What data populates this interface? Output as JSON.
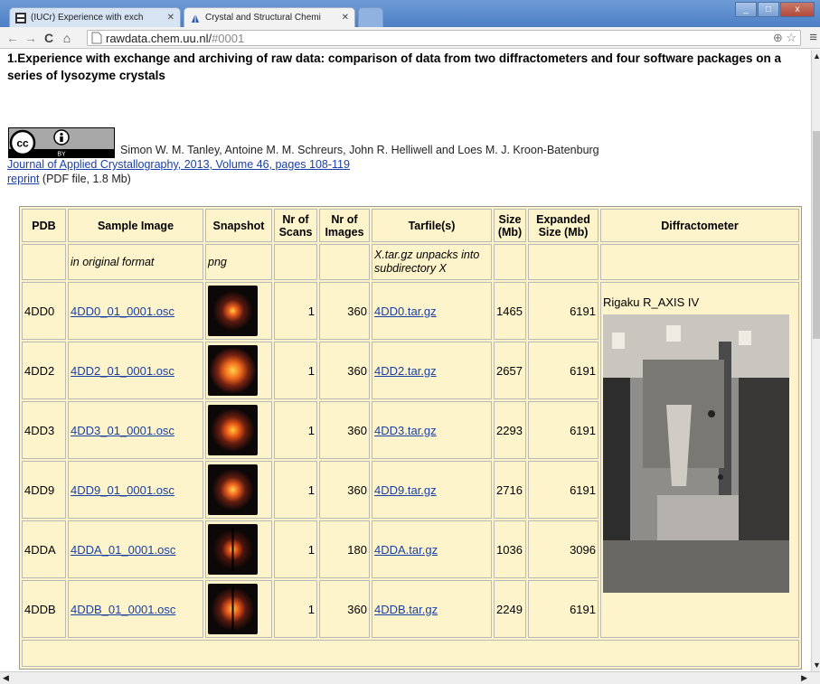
{
  "browser": {
    "tabs": [
      {
        "title": "(IUCr) Experience with exch",
        "active": false
      },
      {
        "title": "Crystal and Structural Chemi",
        "active": true
      }
    ],
    "window_controls": {
      "minimize": "_",
      "maximize": "□",
      "close": "x"
    },
    "url_host": "rawdata.chem.uu.nl/",
    "url_rest": "#0001",
    "icons": [
      "back-icon",
      "forward-icon",
      "reload-icon",
      "home-icon",
      "zoom-icon",
      "star-icon",
      "menu-icon"
    ]
  },
  "page": {
    "title": "1.Experience with exchange and archiving of raw data: comparison of data from two diffractometers and four software packages on a series of lysozyme crystals",
    "license_badge": {
      "cc": "cc",
      "by": "BY"
    },
    "authors": "Simon W. M. Tanley, Antoine M. M. Schreurs, John R. Helliwell and Loes M. J. Kroon-Batenburg",
    "journal_link": "Journal of Applied Crystallography, 2013, Volume 46, pages 108-119",
    "reprint_link": "reprint",
    "reprint_note": " (PDF file, 1.8 Mb)"
  },
  "table": {
    "headers": {
      "pdb": "PDB",
      "sample": "Sample Image",
      "snapshot": "Snapshot",
      "scans": "Nr of Scans",
      "images": "Nr of Images",
      "tarfile": "Tarfile(s)",
      "size": "Size (Mb)",
      "expanded": "Expanded Size (Mb)",
      "diffractometer": "Diffractometer"
    },
    "subheader": {
      "sample": "in original format",
      "snapshot": "png",
      "tarfile": "X.tar.gz unpacks into subdirectory X"
    },
    "diffractometer_name": "Rigaku R_AXIS IV",
    "rows": [
      {
        "pdb": "4DD0",
        "sample": "4DD0_01_0001.osc",
        "scans": "1",
        "images": "360",
        "tar": "4DD0.tar.gz",
        "size": "1465",
        "expanded": "6191"
      },
      {
        "pdb": "4DD2",
        "sample": "4DD2_01_0001.osc",
        "scans": "1",
        "images": "360",
        "tar": "4DD2.tar.gz",
        "size": "2657",
        "expanded": "6191"
      },
      {
        "pdb": "4DD3",
        "sample": "4DD3_01_0001.osc",
        "scans": "1",
        "images": "360",
        "tar": "4DD3.tar.gz",
        "size": "2293",
        "expanded": "6191"
      },
      {
        "pdb": "4DD9",
        "sample": "4DD9_01_0001.osc",
        "scans": "1",
        "images": "360",
        "tar": "4DD9.tar.gz",
        "size": "2716",
        "expanded": "6191"
      },
      {
        "pdb": "4DDA",
        "sample": "4DDA_01_0001.osc",
        "scans": "1",
        "images": "180",
        "tar": "4DDA.tar.gz",
        "size": "1036",
        "expanded": "3096"
      },
      {
        "pdb": "4DDB",
        "sample": "4DDB_01_0001.osc",
        "scans": "1",
        "images": "360",
        "tar": "4DDB.tar.gz",
        "size": "2249",
        "expanded": "6191"
      }
    ]
  },
  "colors": {
    "table_bg": "#fef4cb",
    "link": "#1a3fa6",
    "titlebar": "#5a8ccc"
  }
}
